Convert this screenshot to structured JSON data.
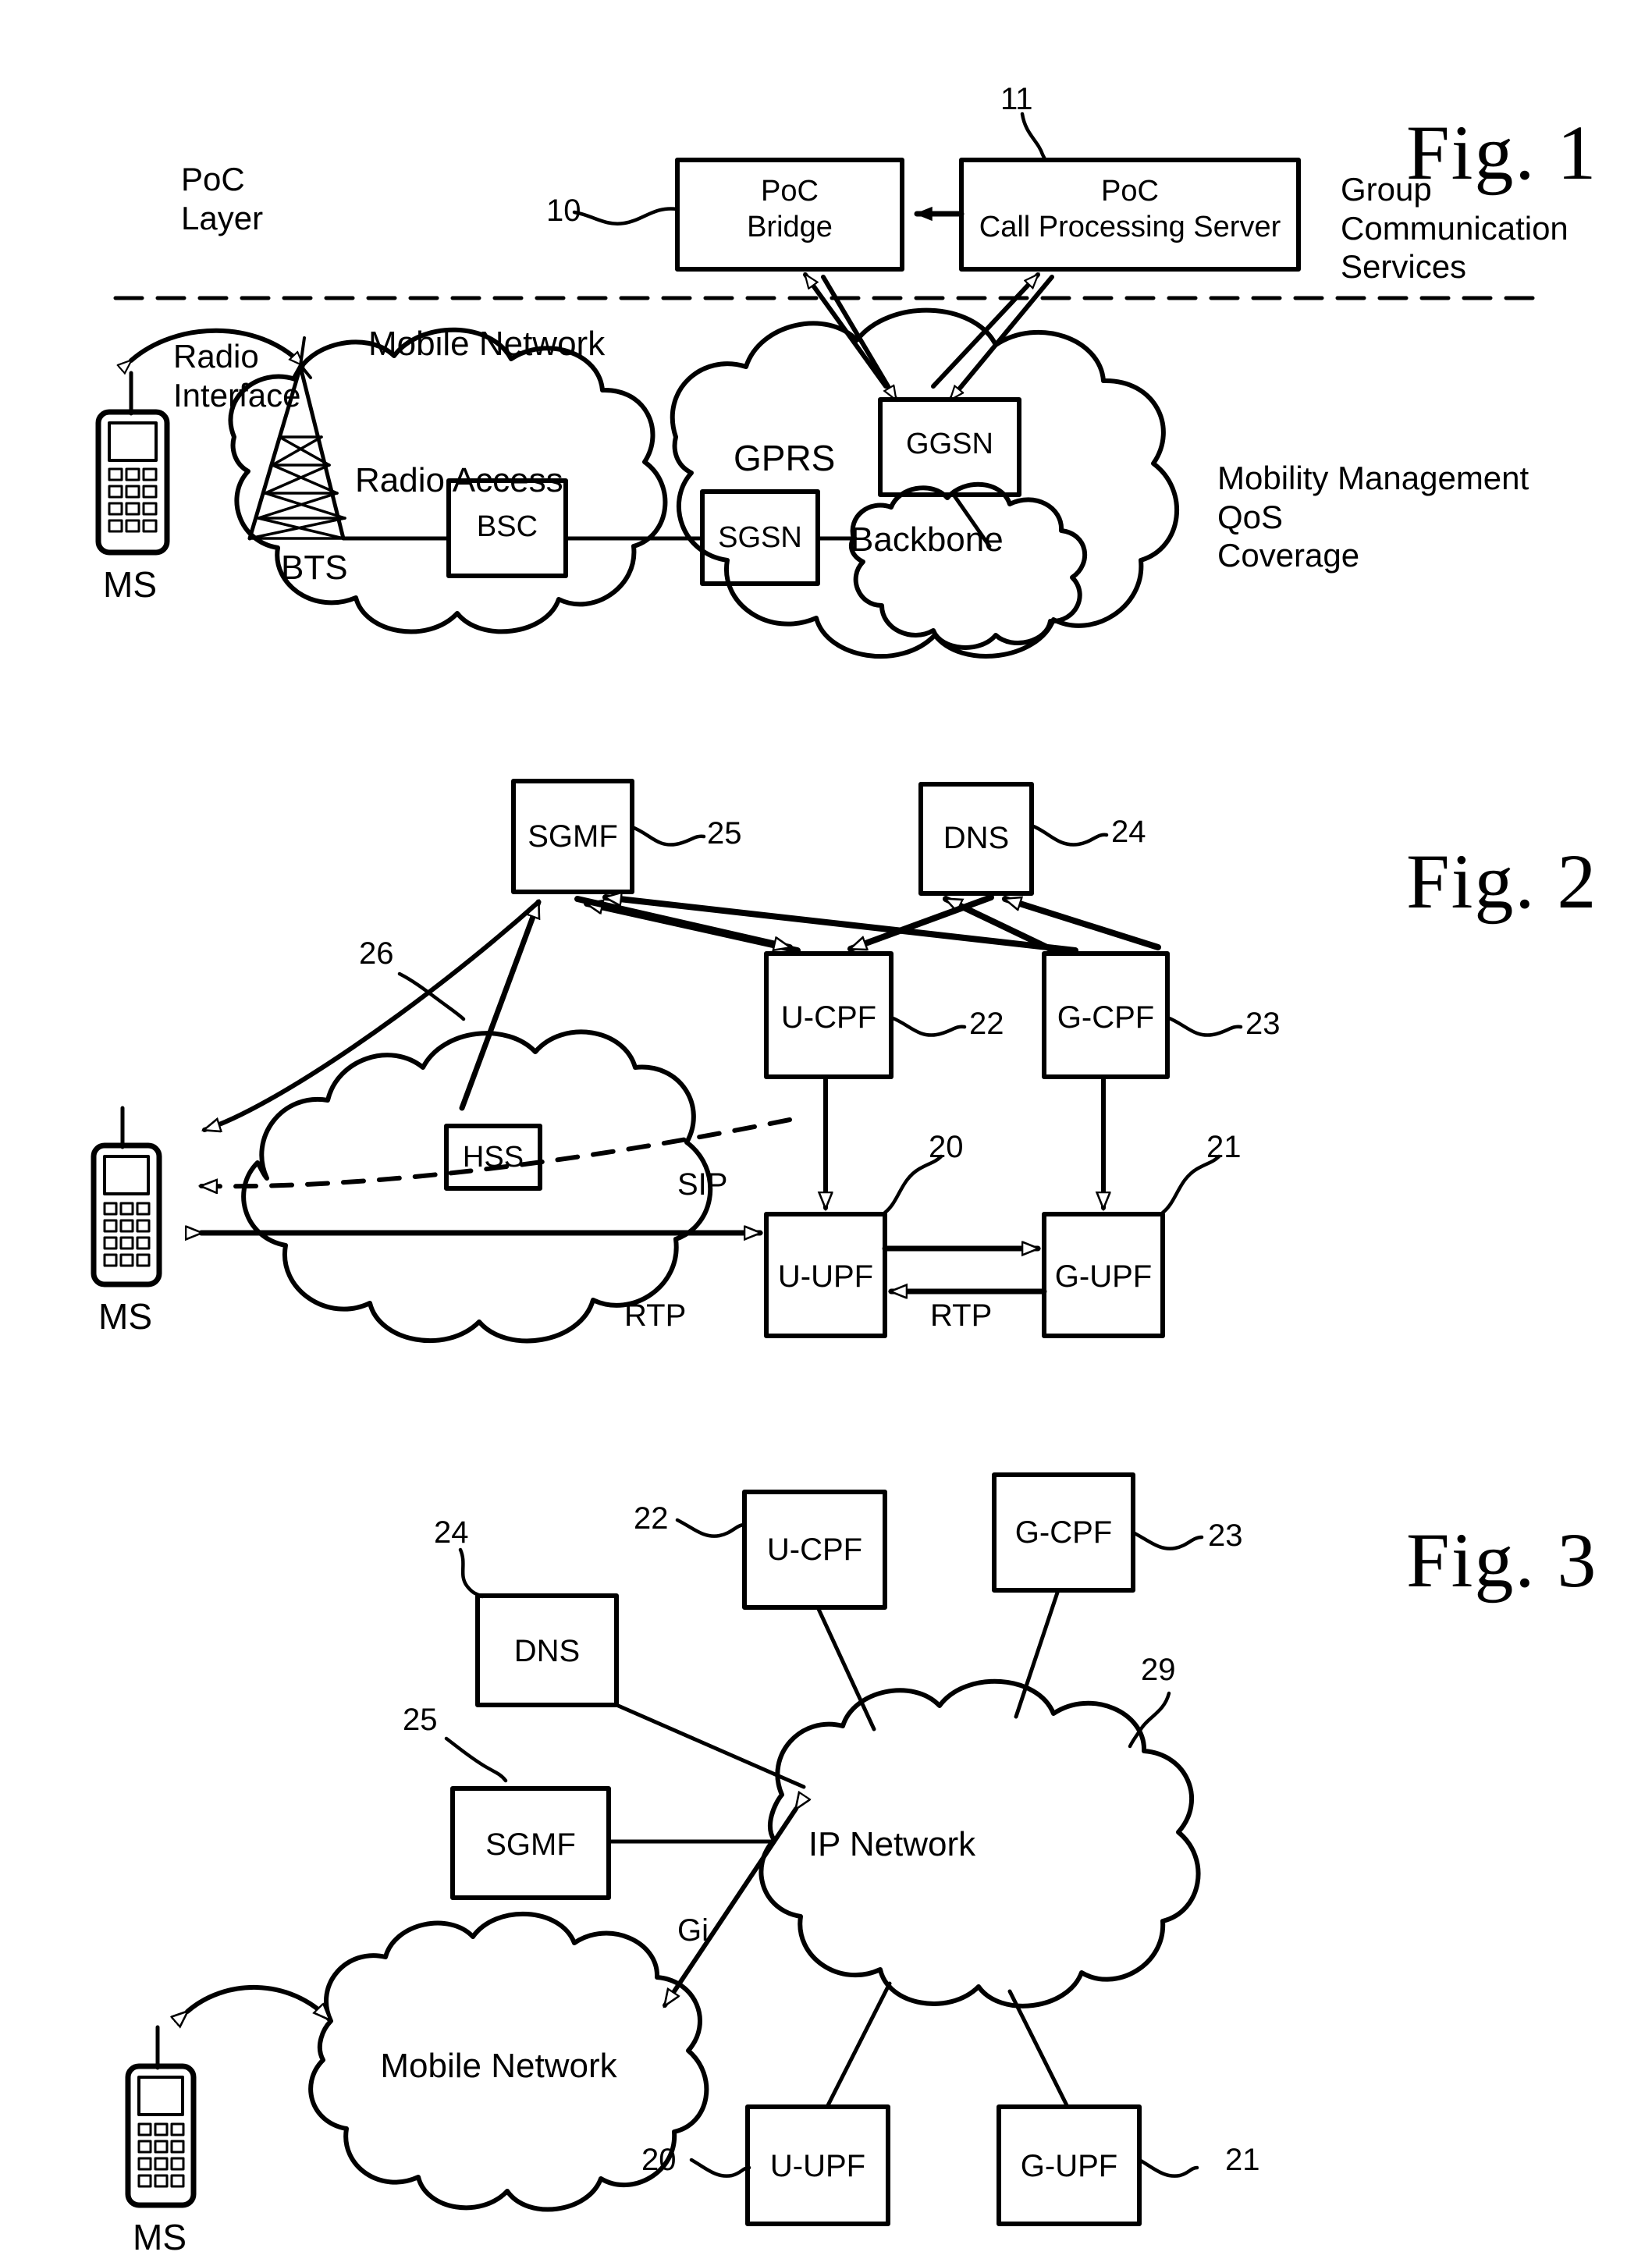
{
  "figures": [
    {
      "id": "fig1",
      "title_prefix": "F",
      "title_mid": "ig",
      "title_dot": ".",
      "title_num": "1",
      "title_full": "Fig. 1",
      "side_labels": {
        "poc_layer": "PoC\nLayer",
        "group_comm": "Group\nCommunication\nServices",
        "mobility": "Mobility Management\nQoS\nCoverage"
      },
      "boxes": [
        {
          "name": "poc-bridge",
          "label": "PoC\nBridge",
          "ref": "10"
        },
        {
          "name": "poc-call-processing-server",
          "label": "PoC\nCall Processing Server",
          "ref": "11"
        },
        {
          "name": "ggsn",
          "label": "GGSN",
          "ref": ""
        },
        {
          "name": "sgsn",
          "label": "SGSN",
          "ref": ""
        },
        {
          "name": "bsc",
          "label": "BSC",
          "ref": ""
        }
      ],
      "clouds": [
        {
          "name": "radio-access-cloud",
          "label": "Radio Access"
        },
        {
          "name": "gprs-cloud",
          "label": "GPRS"
        },
        {
          "name": "backbone-cloud",
          "label": "Backbone"
        }
      ],
      "annotations": {
        "mobile_network": "Mobile Network",
        "radio_interface": "Radio\nInterface",
        "bts": "BTS",
        "ms": "MS"
      }
    },
    {
      "id": "fig2",
      "title_full": "Fig. 2",
      "title_num": "2",
      "boxes": [
        {
          "name": "sgmf",
          "label": "SGMF",
          "ref": "25"
        },
        {
          "name": "dns",
          "label": "DNS",
          "ref": "24"
        },
        {
          "name": "u-cpf",
          "label": "U-CPF",
          "ref": "22"
        },
        {
          "name": "g-cpf",
          "label": "G-CPF",
          "ref": "23"
        },
        {
          "name": "u-upf",
          "label": "U-UPF",
          "ref": "20"
        },
        {
          "name": "g-upf",
          "label": "G-UPF",
          "ref": "21"
        },
        {
          "name": "hss",
          "label": "HSS",
          "ref": ""
        }
      ],
      "clouds": [
        {
          "name": "network-cloud",
          "label": "",
          "ref": "26"
        }
      ],
      "annotations": {
        "ms": "MS",
        "sip": "SIP",
        "rtp_left": "RTP",
        "rtp_right": "RTP"
      }
    },
    {
      "id": "fig3",
      "title_full": "Fig. 3",
      "title_num": "3",
      "boxes": [
        {
          "name": "u-cpf",
          "label": "U-CPF",
          "ref": "22"
        },
        {
          "name": "g-cpf",
          "label": "G-CPF",
          "ref": "23"
        },
        {
          "name": "dns",
          "label": "DNS",
          "ref": "24"
        },
        {
          "name": "sgmf",
          "label": "SGMF",
          "ref": "25"
        },
        {
          "name": "u-upf",
          "label": "U-UPF",
          "ref": "20"
        },
        {
          "name": "g-upf",
          "label": "G-UPF",
          "ref": "21"
        }
      ],
      "clouds": [
        {
          "name": "ip-network-cloud",
          "label": "IP Network",
          "ref": "29"
        },
        {
          "name": "mobile-network-cloud",
          "label": "Mobile Network",
          "ref": ""
        }
      ],
      "annotations": {
        "ms": "MS",
        "gi": "Gi"
      }
    }
  ],
  "colors": {
    "ink": "#000000",
    "paper": "#ffffff"
  }
}
